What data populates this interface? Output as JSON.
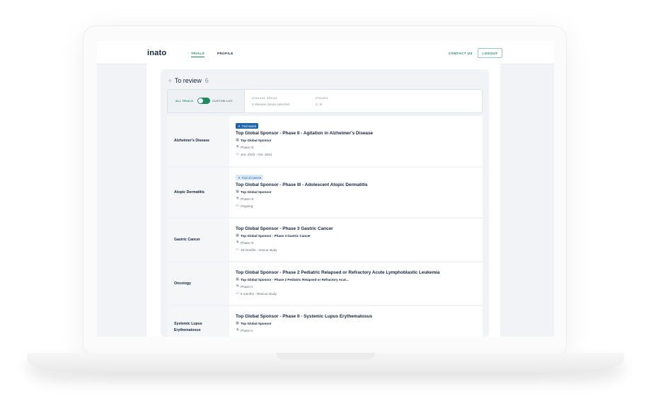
{
  "nav": {
    "logo": "inato",
    "links": [
      {
        "label": "TRIALS",
        "active": true
      },
      {
        "label": "PROFILE",
        "active": false
      }
    ],
    "contact": "CONTACT US",
    "logout": "LOGOUT"
  },
  "review": {
    "title": "To review",
    "count": "6"
  },
  "filters": {
    "toggle_left": "ALL TRIALS",
    "toggle_right": "CUSTOM LIST",
    "disease_areas_label": "DISEASE AREAS",
    "disease_areas_value": "0 disease areas selected",
    "phases_label": "PHASES",
    "phases_value": "II, III"
  },
  "trials": [
    {
      "disease": "Alzheimer's Disease",
      "badge": "Trial match",
      "title": "Top Global Sponsor - Phase II - Agitation in Alzheimer's Disease",
      "sponsor": "Top Global Sponsor",
      "phase": "Phase III",
      "timeline": "Jun. 2023 - Oct. 2024"
    },
    {
      "disease": "Atopic Dermatitis",
      "badge": "Trial of interest",
      "title": "Top Global Sponsor - Phase III - Adolescent Atopic Dermatitis",
      "sponsor": "Top Global Sponsor",
      "phase": "Phase III",
      "timeline": "Ongoing"
    },
    {
      "disease": "Gastric Cancer",
      "badge": "",
      "title": "Top Global Sponsor - Phase 3 Gastric Cancer",
      "sponsor": "Top Global Sponsor - Phase 3 Gastric Cancer",
      "phase": "Phase III",
      "timeline": "18 months - rescue study"
    },
    {
      "disease": "Oncology",
      "badge": "",
      "title": "Top Global Sponsor - Phase 2 Pediatric Relapsed or Refractory Acute Lymphoblastic Leukemia",
      "sponsor": "Top Global Sponsor - Phase 2 Pediatric Relapsed or Refractory Acut...",
      "phase": "Phase II",
      "timeline": "6 months - Rescue study"
    },
    {
      "disease": "Systemic Lupus Erythematosus",
      "badge": "",
      "title": "Top Global Sponsor - Phase II - Systemic Lupus Erythematosus",
      "sponsor": "Top Global Sponsor",
      "phase": "Phase II",
      "timeline": ""
    }
  ],
  "colors": {
    "accent": "#1e8a63",
    "navy": "#16243d",
    "badge_blue": "#1e65ad"
  }
}
